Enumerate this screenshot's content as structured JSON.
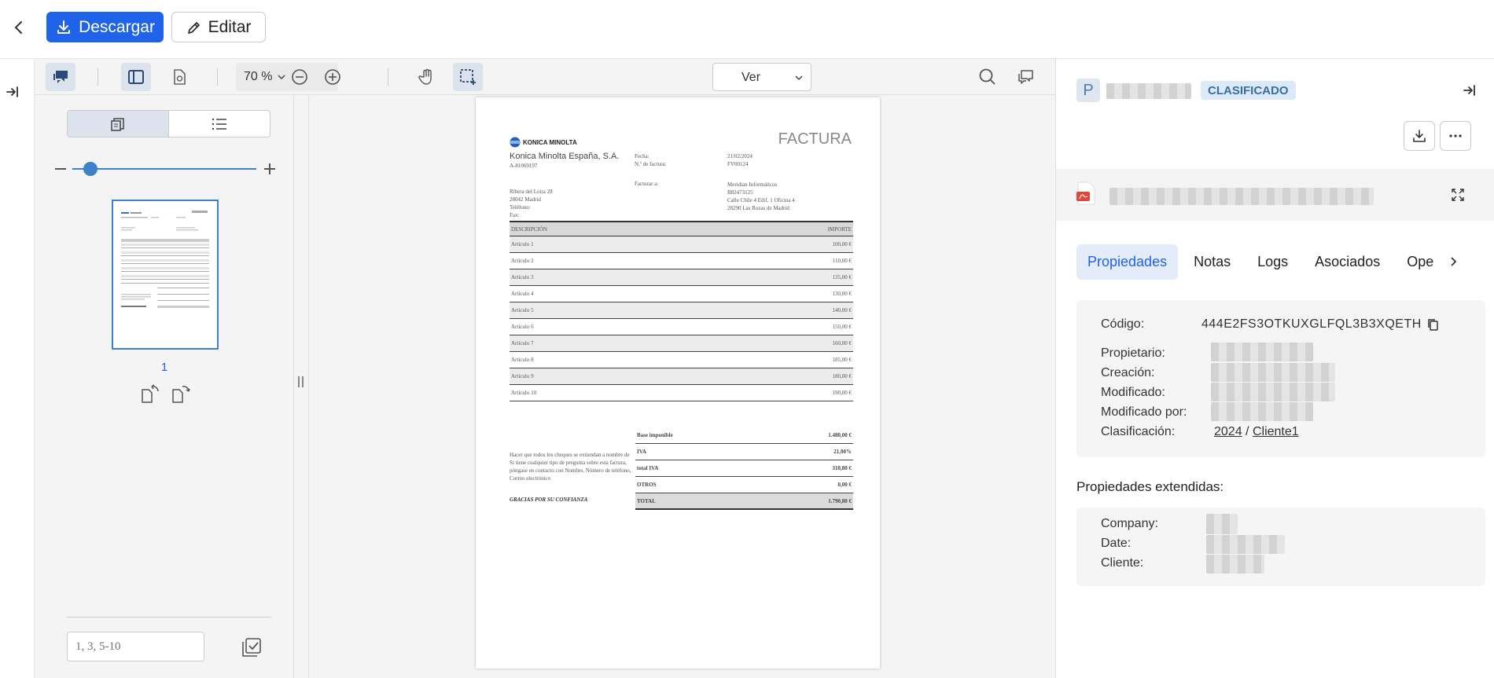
{
  "header": {
    "back_label": "<",
    "download_label": "Descargar",
    "edit_label": "Editar"
  },
  "toolbar": {
    "zoom": "70 %",
    "view_select": "Ver"
  },
  "sidebar": {
    "page_number": "1",
    "page_range_placeholder": "1, 3, 5-10"
  },
  "document": {
    "brand": "KONICA MINOLTA",
    "title": "FACTURA",
    "company": "Konica Minolta España, S.A.",
    "company_id": "A-81069197",
    "fecha_label": "Fecha:",
    "fecha_value": "21/02/2024",
    "factura_label": "N.º de factura:",
    "factura_value": "FV00124",
    "facturar_label": "Facturar a:",
    "address1": "Ribera del Loira 28",
    "address2": "28042 Madrid",
    "telefono": "Teléfono:",
    "fax": "Fax:",
    "client_name": "Meridian Informáticos",
    "client_id": "B82473125",
    "client_addr1": "Calle Chile 4 Edif. 1 Oficina 4",
    "client_addr2": "28290 Las Rozas de Madrid",
    "col_desc": "DESCRIPCIÓN",
    "col_importe": "IMPORTE",
    "items": [
      {
        "desc": "Artículo 1",
        "amount": "100,00 €"
      },
      {
        "desc": "Artículo 2",
        "amount": "110,00 €"
      },
      {
        "desc": "Artículo 3",
        "amount": "135,00 €"
      },
      {
        "desc": "Artículo 4",
        "amount": "130,00 €"
      },
      {
        "desc": "Artículo 5",
        "amount": "140,00 €"
      },
      {
        "desc": "Artículo 6",
        "amount": "150,00 €"
      },
      {
        "desc": "Artículo 7",
        "amount": "160,00 €"
      },
      {
        "desc": "Artículo 8",
        "amount": "185,00 €"
      },
      {
        "desc": "Artículo 9",
        "amount": "180,00 €"
      },
      {
        "desc": "Artículo 10",
        "amount": "190,00 €"
      }
    ],
    "note": "Hacer que todos los cheques se extiendan a nombre de Si tiene cualquier tipo de pregunta sobre esta factura, póngase en contacto con Nombre, Número de teléfono, Correo electrónico",
    "thanks": "GRACIAS POR SU CONFIANZA",
    "totals": [
      {
        "label": "Base imponible",
        "value": "1.480,00 €"
      },
      {
        "label": "IVA",
        "value": "21,00%"
      },
      {
        "label": "total IVA",
        "value": "310,80 €"
      },
      {
        "label": "OTROS",
        "value": "0,00 €"
      },
      {
        "label": "TOTAL",
        "value": "1.790,80 €"
      }
    ]
  },
  "panel": {
    "avatar_letter": "P",
    "status_badge": "CLASIFICADO",
    "tabs": [
      "Propiedades",
      "Notas",
      "Logs",
      "Asociados",
      "Oper"
    ],
    "codigo_label": "Código:",
    "codigo_value": "444E2FS3OTKUXGLFQL3B3XQETH",
    "propietario_label": "Propietario:",
    "creacion_label": "Creación:",
    "modificado_label": "Modificado:",
    "modificado_por_label": "Modificado por:",
    "clasificacion_label": "Clasificación:",
    "clasificacion_year": "2024",
    "clasificacion_sep": "/",
    "clasificacion_client": "Cliente1",
    "extended_title": "Propiedades extendidas:",
    "company_label": "Company:",
    "date_label": "Date:",
    "cliente_label": "Cliente:"
  }
}
